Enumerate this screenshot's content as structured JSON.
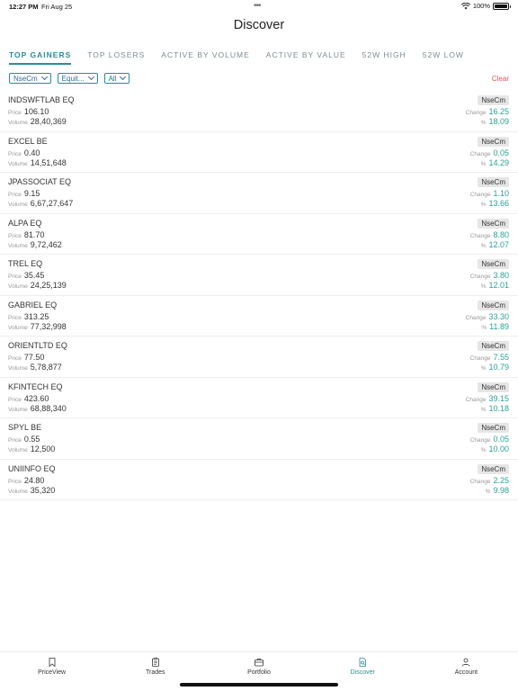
{
  "status": {
    "time": "12:27 PM",
    "date": "Fri Aug 25",
    "battery": "100%"
  },
  "page": {
    "title": "Discover"
  },
  "tabs": [
    {
      "label": "TOP GAINERS",
      "active": true
    },
    {
      "label": "TOP LOSERS",
      "active": false
    },
    {
      "label": "ACTIVE BY VOLUME",
      "active": false
    },
    {
      "label": "ACTIVE BY VALUE",
      "active": false
    },
    {
      "label": "52W HIGH",
      "active": false
    },
    {
      "label": "52W LOW",
      "active": false
    }
  ],
  "filters": {
    "exchange": "NseCm",
    "segment": "Equit...",
    "group": "All",
    "clear": "Clear"
  },
  "labels": {
    "price": "Price",
    "volume": "Volume",
    "change": "Change",
    "percent": "%"
  },
  "stocks": [
    {
      "name": "INDSWFTLAB EQ",
      "exchange": "NseCm",
      "price": "106.10",
      "volume": "28,40,369",
      "change": "16.25",
      "percent": "18.09"
    },
    {
      "name": "EXCEL BE",
      "exchange": "NseCm",
      "price": "0.40",
      "volume": "14,51,648",
      "change": "0.05",
      "percent": "14.29"
    },
    {
      "name": "JPASSOCIAT EQ",
      "exchange": "NseCm",
      "price": "9.15",
      "volume": "6,67,27,647",
      "change": "1.10",
      "percent": "13.66"
    },
    {
      "name": "ALPA EQ",
      "exchange": "NseCm",
      "price": "81.70",
      "volume": "9,72,462",
      "change": "8.80",
      "percent": "12.07"
    },
    {
      "name": "TREL EQ",
      "exchange": "NseCm",
      "price": "35.45",
      "volume": "24,25,139",
      "change": "3.80",
      "percent": "12.01"
    },
    {
      "name": "GABRIEL EQ",
      "exchange": "NseCm",
      "price": "313.25",
      "volume": "77,32,998",
      "change": "33.30",
      "percent": "11.89"
    },
    {
      "name": "ORIENTLTD EQ",
      "exchange": "NseCm",
      "price": "77.50",
      "volume": "5,78,877",
      "change": "7.55",
      "percent": "10.79"
    },
    {
      "name": "KFINTECH EQ",
      "exchange": "NseCm",
      "price": "423.60",
      "volume": "68,88,340",
      "change": "39.15",
      "percent": "10.18"
    },
    {
      "name": "SPYL BE",
      "exchange": "NseCm",
      "price": "0.55",
      "volume": "12,500",
      "change": "0.05",
      "percent": "10.00"
    },
    {
      "name": "UNIINFO EQ",
      "exchange": "NseCm",
      "price": "24.80",
      "volume": "35,320",
      "change": "2.25",
      "percent": "9.98"
    }
  ],
  "nav": [
    {
      "label": "PriceView",
      "icon": "bookmark-icon",
      "active": false
    },
    {
      "label": "Trades",
      "icon": "clipboard-icon",
      "active": false
    },
    {
      "label": "Portfolio",
      "icon": "briefcase-icon",
      "active": false
    },
    {
      "label": "Discover",
      "icon": "discover-icon",
      "active": true
    },
    {
      "label": "Account",
      "icon": "person-icon",
      "active": false
    }
  ],
  "colors": {
    "accent": "#2a8c98",
    "gain": "#2aa198",
    "clear": "#e05656"
  }
}
